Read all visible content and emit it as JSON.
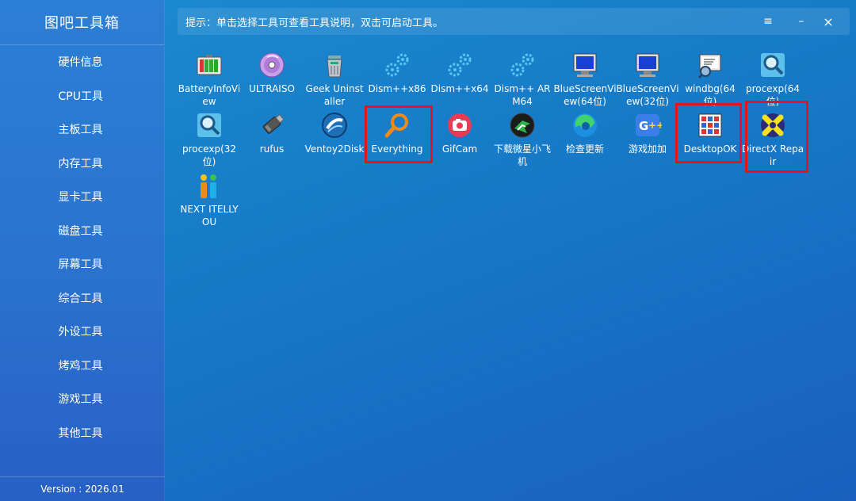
{
  "app": {
    "title": "图吧工具箱",
    "version": "Version : 2026.01"
  },
  "sidebar": {
    "items": [
      {
        "label": "硬件信息"
      },
      {
        "label": "CPU工具"
      },
      {
        "label": "主板工具"
      },
      {
        "label": "内存工具"
      },
      {
        "label": "显卡工具"
      },
      {
        "label": "磁盘工具"
      },
      {
        "label": "屏幕工具"
      },
      {
        "label": "综合工具"
      },
      {
        "label": "外设工具"
      },
      {
        "label": "烤鸡工具"
      },
      {
        "label": "游戏工具"
      },
      {
        "label": "其他工具"
      }
    ]
  },
  "header": {
    "hint": "提示：单击选择工具可查看工具说明，双击可启动工具。",
    "menu_icon": "≡",
    "minimize_icon": "–",
    "close_icon": "×"
  },
  "tools": [
    {
      "label": "BatteryInfoView",
      "icon": "battery-icon"
    },
    {
      "label": "ULTRAISO",
      "icon": "disc-icon"
    },
    {
      "label": "Geek Uninstaller",
      "icon": "trash-can-icon"
    },
    {
      "label": "Dism++x86",
      "icon": "gears-icon"
    },
    {
      "label": "Dism++x64",
      "icon": "gears-icon"
    },
    {
      "label": "Dism++ ARM64",
      "icon": "gears-icon"
    },
    {
      "label": "BlueScreenView(64位)",
      "icon": "monitor-icon"
    },
    {
      "label": "BlueScreenView(32位)",
      "icon": "monitor-icon"
    },
    {
      "label": "windbg(64位)",
      "icon": "debugger-icon"
    },
    {
      "label": "procexp(64位)",
      "icon": "magnifier-icon"
    },
    {
      "label": "procexp(32位)",
      "icon": "magnifier-icon"
    },
    {
      "label": "rufus",
      "icon": "usb-drive-icon"
    },
    {
      "label": "Ventoy2Disk",
      "icon": "ventoy-icon"
    },
    {
      "label": "Everything",
      "icon": "search-magnifier-icon"
    },
    {
      "label": "GifCam",
      "icon": "camera-icon"
    },
    {
      "label": "下载微星小飞机",
      "icon": "afterburner-icon"
    },
    {
      "label": "检查更新",
      "icon": "edge-icon"
    },
    {
      "label": "游戏加加",
      "icon": "game-plus-icon"
    },
    {
      "label": "DesktopOK",
      "icon": "desktop-grid-icon"
    },
    {
      "label": "DirectX Repair",
      "icon": "directx-icon"
    },
    {
      "label": "NEXT ITELLYOU",
      "icon": "itellyou-icon"
    }
  ],
  "colors": {
    "sidebar_bg": "#2a74cf",
    "main_bg": "#1678c6",
    "highlight": "#e3151c"
  }
}
